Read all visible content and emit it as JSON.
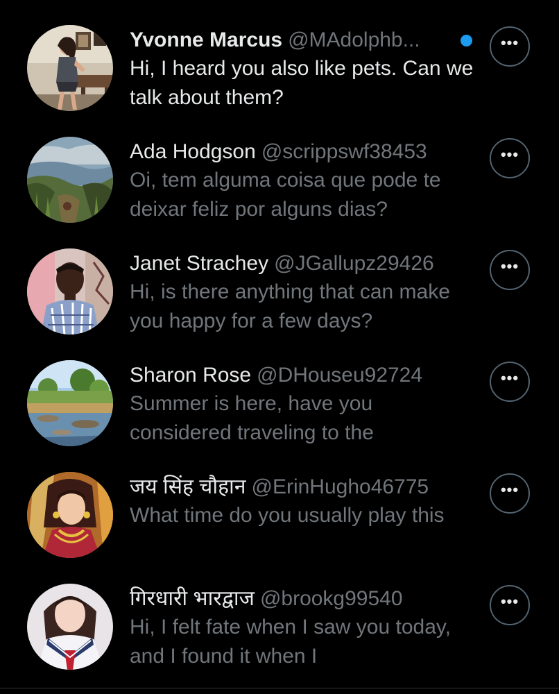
{
  "messages": [
    {
      "name": "Yvonne Marcus",
      "handle": "@MAdolphb...",
      "text": "Hi, I heard you also like pets. Can we talk about them?",
      "unread": true,
      "avatar_icon": "woman-in-room-photo"
    },
    {
      "name": "Ada Hodgson",
      "handle": "@scrippswf38453",
      "text": "Oi, tem alguma coisa que pode te deixar feliz por alguns dias?",
      "unread": false,
      "avatar_icon": "grass-hill-landscape-photo"
    },
    {
      "name": "Janet Strachey",
      "handle": "@JGallupz29426",
      "text": "Hi, is there anything that can make you happy for a few days?",
      "unread": false,
      "avatar_icon": "man-portrait-photo"
    },
    {
      "name": "Sharon Rose",
      "handle": "@DHouseu92724",
      "text": "Summer is here, have you considered traveling to the",
      "unread": false,
      "avatar_icon": "river-landscape-photo"
    },
    {
      "name": "जय सिंह चौहान",
      "handle": "@ErinHugho46775",
      "text": "What time do you usually play this",
      "unread": false,
      "avatar_icon": "woman-in-sari-photo"
    },
    {
      "name": "गिरधारी भारद्वाज",
      "handle": "@brookg99540",
      "text": "Hi, I felt fate when I saw you today, and I found it when I",
      "unread": false,
      "avatar_icon": "girl-sailor-uniform-photo"
    }
  ],
  "more_button_label": "•••",
  "colors": {
    "background": "#000000",
    "primary_text": "#e7e9ea",
    "secondary_text": "#71767b",
    "unread_dot": "#1d9bf0"
  }
}
